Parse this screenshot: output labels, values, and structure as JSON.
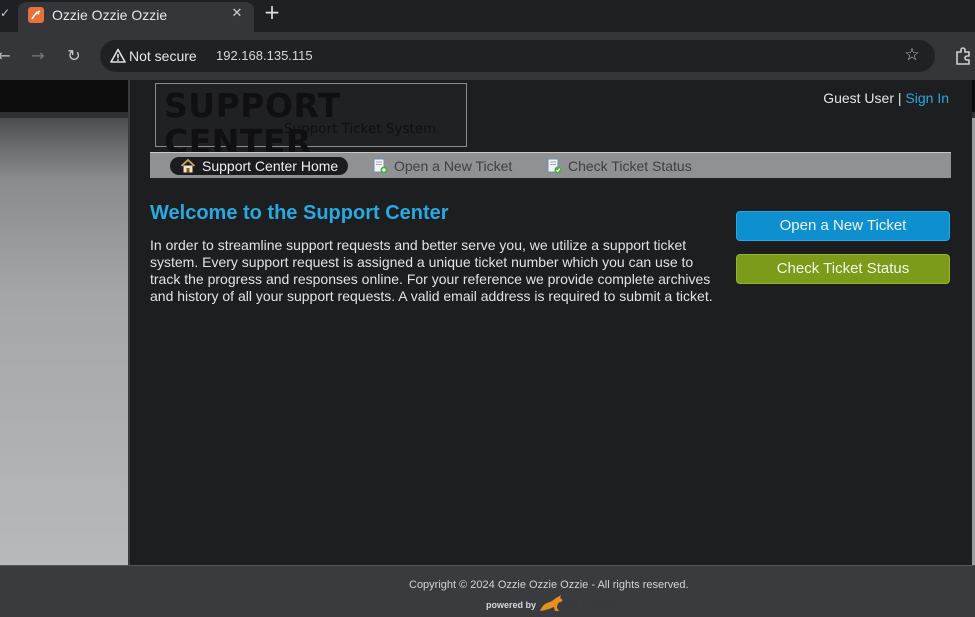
{
  "browser": {
    "tab_title": "Ozzie Ozzie Ozzie",
    "close_glyph": "✕",
    "new_tab_glyph": "+",
    "security_label": "Not secure",
    "url": "192.168.135.115"
  },
  "header": {
    "logo_title": "SUPPORT CENTER",
    "logo_subtitle": "Support Ticket System",
    "guest_label": "Guest User |",
    "signin_label": "Sign In"
  },
  "nav": {
    "items": [
      {
        "label": "Support Center Home",
        "icon": "home-icon",
        "active": true
      },
      {
        "label": "Open a New Ticket",
        "icon": "new-ticket-icon",
        "active": false
      },
      {
        "label": "Check Ticket Status",
        "icon": "ticket-status-icon",
        "active": false
      }
    ]
  },
  "main": {
    "heading": "Welcome to the Support Center",
    "intro": "In order to streamline support requests and better serve you, we utilize a support ticket system. Every support request is assigned a unique ticket number which you can use to track the progress and responses online. For your reference we provide complete archives and history of all your support requests. A valid email address is required to submit a ticket.",
    "open_ticket_button": "Open a New Ticket",
    "check_status_button": "Check Ticket Status"
  },
  "footer": {
    "copyright": "Copyright © 2024 Ozzie Ozzie Ozzie - All rights reserved.",
    "powered_by": "powered by",
    "brand": "osTicket"
  },
  "colors": {
    "accent_blue": "#28a9e1",
    "button_blue": "#0e8fcf",
    "button_green": "#7c9b1a"
  }
}
